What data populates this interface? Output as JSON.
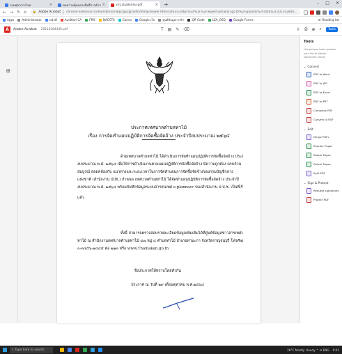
{
  "browser": {
    "tabs": [
      {
        "label": "กรมศุลกากรไทย",
        "fav_color": "#3b78e7"
      },
      {
        "label": "ขอความคุ้มครองสิทธิ์การค้าฯ",
        "fav_color": "#3b78e7"
      },
      {
        "label": "20110284440.pdf",
        "fav_color": "#d9251d",
        "active": true
      }
    ],
    "new_tab": "+",
    "address": {
      "site": "Adobe Acrobat",
      "url": "chrome-extension://efaidnbmnnnibpcajpcglclefindmkaj/viewer.html?pdfurl=https%3A%2F%2Fwww.thamakan.go.th%2Fuploads%2Fdata%2F20110284440.pdf&clen=..."
    },
    "bookmarks": [
      {
        "label": "Apps",
        "color": "#4285f4"
      },
      {
        "label": "Administrator",
        "color": "#888888"
      },
      {
        "label": "หน้าที่",
        "color": "#4285f4"
      },
      {
        "label": "Audition CA",
        "color": "#e84c3d"
      },
      {
        "label": "FMS",
        "color": "#34a853"
      },
      {
        "label": "NACCTA",
        "color": "#fbbc05"
      },
      {
        "label": "Canva",
        "color": "#00c4cc"
      },
      {
        "label": "Google เว็บ",
        "color": "#4285f4"
      },
      {
        "label": "ศูนย์ข้อมูลการค้า",
        "color": "#888888"
      },
      {
        "label": "QR Code",
        "color": "#333333"
      },
      {
        "label": "LEA_OSD",
        "color": "#34a853"
      },
      {
        "label": "Google Forms",
        "color": "#7248b9"
      }
    ],
    "bookmarks_right": "Reading list"
  },
  "acrobat": {
    "app_name": "Adobe Acrobat",
    "file_name": "20110284440.pdf",
    "mid_tools": "T  ✎  ⁄  ⁄",
    "right_icons": "⇩  ⎙  ⊕  🔍",
    "tools_label": "Tools"
  },
  "document": {
    "title_line1": "ประกาศเทศบาลตำบลท่าไม้",
    "title_line2": "เรื่อง การจัดทำแผนปฏิบัติการจัดซื้อจัดจ้าง ประจำปีงบประมาณ ๒๕๖๔",
    "para1": [
      "ด้วยเทศบาลตำบลท่าไม้ ได้ดำเนินการจัดทำแผนปฏิบัติการจัดซื้อจัดจ้าง ประจำปี",
      "งบประมาณ พ.ศ. ๒๕๖๔ เพื่อให้การดำเนินงานตามแผนปฏิบัติการจัดซื้อจัดจ้าง มีความถูกต้อง ครบถ้วน",
      "สมบูรณ์ สอดคล้องกับ แนวทางและระยะเวลาในการจัดทำแผนการจัดซื้อจัดจ้างของกรมบัญชีกลาง",
      "แห่งชาติ (สำนักงาน ปปช.) กำหนด เทศบาลตำบลท่าไม้ ได้จัดทำแผนปฏิบัติการจัดซื้อจัดจ้าง ประจำปี",
      "งบประมาณ พ.ศ. ๒๕๖๔ พร้อมบันทึกข้อมูลระบบสารสนเทศ e-plannacc ของสำนักงาน ป.ป.ช. เป็นที่เรียบร้อย",
      "แล้ว"
    ],
    "para2": [
      "ทั้งนี้ สามารถตรวจสอบรายละเอียดข้อมูลเพิ่มเติมได้ที่ศูนย์ข้อมูลข่าวสารเทศบาลตำบล",
      "ท่าไม้ ณ สำนักงานเทศบาลตำบลท่าไม้ ๔๗ หมู่ ๔ ตำบลท่าไม้ อำเภอท่ามะกา จังหวัดกาญจนบุรี โทรศัพท์",
      "๐-๓๔๕๖-๑๔๔๕ ต่อ ๒๒๓ หรือ www.Thamakan.go.th"
    ],
    "closing1": "จึงประกาศให้ทราบโดยทั่วกัน",
    "closing2": "ประกาศ ณ วันที่ ๒๙ เดือนตุลาคม พ.ศ.๒๕๖๔"
  },
  "tools_panel": {
    "title": "Tools",
    "description": "Using these tools uploads your file to Adobe Document Cloud.",
    "sections": [
      {
        "label": "Convert",
        "items": [
          {
            "label": "PDF to Word",
            "color": "#2b5fbf"
          },
          {
            "label": "PDF to JPG",
            "color": "#d24aa0"
          },
          {
            "label": "PDF to Excel",
            "color": "#1d8a47"
          },
          {
            "label": "PDF to PPT",
            "color": "#d25f2b"
          },
          {
            "label": "Compress PDF",
            "color": "#c23a3a"
          },
          {
            "label": "Convert to PDF",
            "color": "#c23a3a"
          }
        ]
      },
      {
        "label": "Edit",
        "items": [
          {
            "label": "Merge PDFs",
            "color": "#7b5cc7"
          },
          {
            "label": "Reorder Pages",
            "color": "#1d8a47"
          },
          {
            "label": "Rotate Pages",
            "color": "#1d8a47"
          },
          {
            "label": "Delete Pages",
            "color": "#1d8a47"
          },
          {
            "label": "Split PDF",
            "color": "#7b5cc7"
          }
        ]
      },
      {
        "label": "Sign & Protect",
        "items": [
          {
            "label": "Request signatures",
            "color": "#7b5cc7"
          },
          {
            "label": "Protect PDF",
            "color": "#c23a3a"
          }
        ]
      }
    ]
  },
  "taskbar": {
    "search_placeholder": "Type here to search",
    "tray_text": "26°C  Mostly cloudy  ^  ⊡  ENG",
    "time": "9:01",
    "app_colors": [
      "#f0b400",
      "#4285f4",
      "#d9251d",
      "#34a853",
      "#2d9cdb",
      "#1e90ff"
    ]
  }
}
